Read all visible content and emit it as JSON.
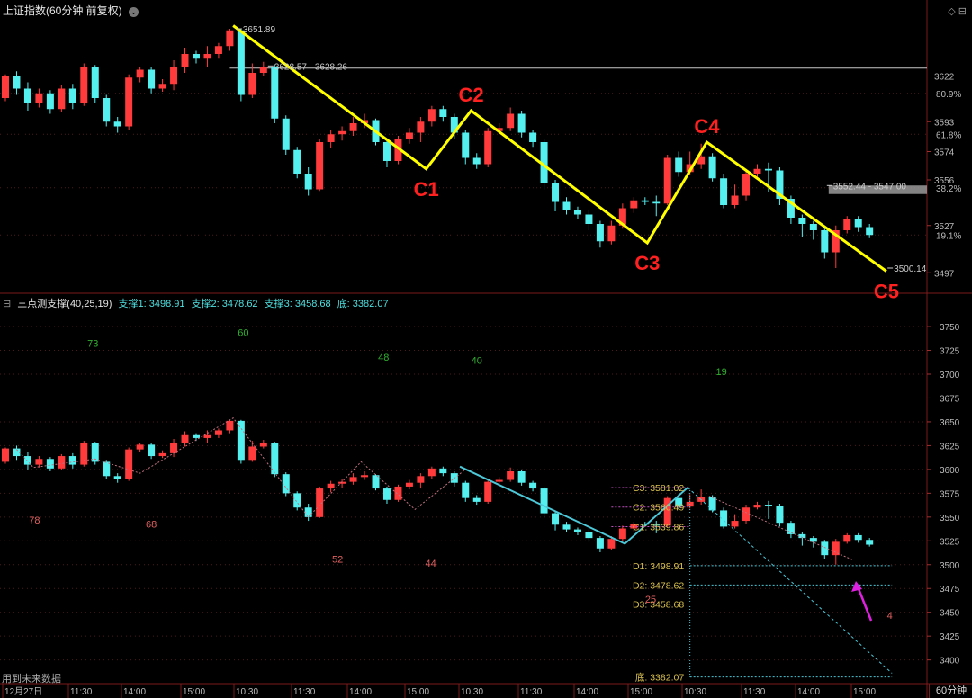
{
  "header": {
    "title": "上证指数(60分钟 前复权)",
    "controls": "◇ ⊟"
  },
  "indicator_header": {
    "name": "三点测支撑(40,25,19)",
    "s1": "支撑1: 3498.91",
    "s2": "支撑2: 3478.62",
    "s3": "支撑3: 3458.68",
    "bottom": "底: 3382.07"
  },
  "period_label": "60分钟",
  "footer_note": "用到未来数据",
  "colors": {
    "up": "#ff3b3b",
    "down": "#54f0f0",
    "zigzag": "#ffff00",
    "label": "#ff2020",
    "trend": "#4cc8d8",
    "dotted": "#d8c050",
    "arrow": "#e020e0",
    "grid": "#4a1a1a",
    "axis": "#7a1a1a"
  },
  "time_axis": [
    "12月27日",
    "11:30",
    "14:00",
    "15:00",
    "10:30",
    "11:30",
    "14:00",
    "15:00",
    "10:30",
    "11:30",
    "14:00",
    "15:00",
    "10:30",
    "11:30",
    "14:00",
    "15:00"
  ],
  "chart_data": [
    {
      "type": "candlestick",
      "title": "上证指数(60分钟 前复权)",
      "y_ticks": [
        3622,
        3593,
        3574,
        3556,
        3527,
        3497
      ],
      "pct_ticks": [
        {
          "label": "80.9%",
          "value": 3611
        },
        {
          "label": "61.8%",
          "value": 3585
        },
        {
          "label": "38.2%",
          "value": 3551
        },
        {
          "label": "19.1%",
          "value": 3521
        }
      ],
      "ylim": [
        3484,
        3660
      ],
      "candles": [
        [
          3608,
          3622,
          3623,
          3606
        ],
        [
          3622,
          3614,
          3625,
          3610
        ],
        [
          3614,
          3605,
          3618,
          3600
        ],
        [
          3605,
          3611,
          3614,
          3602
        ],
        [
          3611,
          3601,
          3613,
          3598
        ],
        [
          3601,
          3614,
          3616,
          3599
        ],
        [
          3614,
          3605,
          3617,
          3601
        ],
        [
          3605,
          3628,
          3630,
          3603
        ],
        [
          3628,
          3608,
          3629,
          3605
        ],
        [
          3608,
          3593,
          3610,
          3590
        ],
        [
          3593,
          3590,
          3596,
          3586
        ],
        [
          3590,
          3621,
          3623,
          3588
        ],
        [
          3621,
          3626,
          3628,
          3618
        ],
        [
          3626,
          3614,
          3628,
          3611
        ],
        [
          3614,
          3617,
          3620,
          3612
        ],
        [
          3617,
          3628,
          3632,
          3613
        ],
        [
          3628,
          3636,
          3640,
          3624
        ],
        [
          3636,
          3633,
          3638,
          3630
        ],
        [
          3633,
          3636,
          3641,
          3628
        ],
        [
          3636,
          3641,
          3643,
          3633
        ],
        [
          3641,
          3651,
          3652,
          3638
        ],
        [
          3651,
          3610,
          3652,
          3606
        ],
        [
          3610,
          3624,
          3630,
          3608
        ],
        [
          3624,
          3628,
          3631,
          3622
        ],
        [
          3628,
          3595,
          3629,
          3592
        ],
        [
          3595,
          3575,
          3597,
          3572
        ],
        [
          3575,
          3560,
          3577,
          3557
        ],
        [
          3560,
          3550,
          3564,
          3546
        ],
        [
          3550,
          3580,
          3582,
          3549
        ],
        [
          3580,
          3585,
          3588,
          3576
        ],
        [
          3585,
          3587,
          3590,
          3581
        ],
        [
          3587,
          3592,
          3596,
          3584
        ],
        [
          3592,
          3594,
          3598,
          3589
        ],
        [
          3594,
          3580,
          3595,
          3578
        ],
        [
          3580,
          3568,
          3582,
          3564
        ],
        [
          3568,
          3582,
          3584,
          3566
        ],
        [
          3582,
          3586,
          3589,
          3579
        ],
        [
          3586,
          3593,
          3596,
          3580
        ],
        [
          3593,
          3601,
          3603,
          3590
        ],
        [
          3601,
          3596,
          3603,
          3593
        ],
        [
          3596,
          3586,
          3598,
          3582
        ],
        [
          3586,
          3570,
          3588,
          3566
        ],
        [
          3570,
          3566,
          3573,
          3563
        ],
        [
          3566,
          3587,
          3589,
          3564
        ],
        [
          3587,
          3589,
          3592,
          3585
        ],
        [
          3589,
          3598,
          3602,
          3587
        ],
        [
          3598,
          3586,
          3600,
          3583
        ],
        [
          3586,
          3580,
          3588,
          3577
        ],
        [
          3580,
          3554,
          3582,
          3550
        ],
        [
          3554,
          3542,
          3556,
          3536
        ],
        [
          3542,
          3537,
          3545,
          3534
        ],
        [
          3537,
          3534,
          3539,
          3531
        ],
        [
          3534,
          3528,
          3537,
          3524
        ],
        [
          3528,
          3517,
          3530,
          3513
        ],
        [
          3517,
          3527,
          3530,
          3515
        ],
        [
          3527,
          3538,
          3541,
          3525
        ],
        [
          3538,
          3543,
          3545,
          3535
        ],
        [
          3543,
          3542,
          3545,
          3540
        ],
        [
          3542,
          3541,
          3546,
          3533
        ],
        [
          3541,
          3570,
          3572,
          3540
        ],
        [
          3570,
          3561,
          3574,
          3558
        ],
        [
          3561,
          3566,
          3574,
          3559
        ],
        [
          3566,
          3571,
          3579,
          3563
        ],
        [
          3571,
          3557,
          3573,
          3555
        ],
        [
          3557,
          3540,
          3560,
          3538
        ],
        [
          3540,
          3546,
          3553,
          3538
        ],
        [
          3546,
          3560,
          3563,
          3543
        ],
        [
          3560,
          3563,
          3566,
          3558
        ],
        [
          3563,
          3562,
          3567,
          3548
        ],
        [
          3562,
          3544,
          3564,
          3540
        ],
        [
          3544,
          3532,
          3546,
          3528
        ],
        [
          3532,
          3528,
          3534,
          3520
        ],
        [
          3528,
          3524,
          3530,
          3518
        ],
        [
          3524,
          3510,
          3526,
          3506
        ],
        [
          3510,
          3524,
          3527,
          3500
        ],
        [
          3524,
          3531,
          3533,
          3522
        ],
        [
          3531,
          3526,
          3533,
          3523
        ],
        [
          3526,
          3521,
          3528,
          3519
        ]
      ],
      "zigzag": [
        {
          "i": 20.3,
          "v": 3654
        },
        {
          "i": 37.5,
          "v": 3563
        },
        {
          "i": 41.5,
          "v": 3600
        },
        {
          "i": 57.2,
          "v": 3516
        },
        {
          "i": 62.5,
          "v": 3580
        },
        {
          "i": 78.5,
          "v": 3498
        }
      ],
      "zigzag_labels": [
        {
          "label": "C1",
          "i": 37.5,
          "v": 3563,
          "pos": "below"
        },
        {
          "label": "C2",
          "i": 41.5,
          "v": 3600,
          "pos": "above"
        },
        {
          "label": "C3",
          "i": 57.2,
          "v": 3516,
          "pos": "below"
        },
        {
          "label": "C4",
          "i": 62.5,
          "v": 3580,
          "pos": "above"
        },
        {
          "label": "C5",
          "i": 78.5,
          "v": 3498,
          "pos": "below"
        }
      ],
      "annotations": [
        {
          "text": "3651.89",
          "i": 20.6,
          "v": 3652
        },
        {
          "text": "3628.57 - 3628.26",
          "i": 23.4,
          "v": 3628.4
        },
        {
          "text": "3552.44 - 3547.00",
          "i": 73.2,
          "v": 3552.4
        },
        {
          "text": "3500.14",
          "i": 78.6,
          "v": 3500
        }
      ],
      "hline": {
        "v": 3627
      },
      "gap_box": {
        "from_i": 73.2,
        "to": 3547,
        "top": 3552.44
      }
    },
    {
      "type": "candlestick",
      "title": "三点测支撑(40,25,19)",
      "y_ticks": [
        3750,
        3725,
        3700,
        3675,
        3650,
        3625,
        3600,
        3575,
        3550,
        3525,
        3500,
        3475,
        3450,
        3425,
        3400
      ],
      "ylim": [
        3377,
        3768
      ],
      "support_levels": [
        {
          "label": "C3: 3581.02",
          "value": 3581.02
        },
        {
          "label": "C2: 3560.49",
          "value": 3560.49
        },
        {
          "label": "C1: 3539.86",
          "value": 3539.86
        },
        {
          "label": "D1: 3498.91",
          "value": 3498.91
        },
        {
          "label": "D2: 3478.62",
          "value": 3478.62
        },
        {
          "label": "D3: 3458.68",
          "value": 3458.68
        },
        {
          "label": "底: 3382.07",
          "value": 3382.07
        }
      ],
      "numbers": [
        {
          "text": "73",
          "i": 7.8,
          "v": 3729,
          "color": "#30b030"
        },
        {
          "text": "60",
          "i": 21.2,
          "v": 3740,
          "color": "#30b030"
        },
        {
          "text": "48",
          "i": 33.7,
          "v": 3714,
          "color": "#30b030"
        },
        {
          "text": "40",
          "i": 42.0,
          "v": 3711,
          "color": "#30b030"
        },
        {
          "text": "19",
          "i": 63.8,
          "v": 3699,
          "color": "#30b030"
        },
        {
          "text": "78",
          "i": 2.6,
          "v": 3543,
          "color": "#e06060"
        },
        {
          "text": "68",
          "i": 13.0,
          "v": 3539,
          "color": "#e06060"
        },
        {
          "text": "52",
          "i": 29.6,
          "v": 3502,
          "color": "#e06060"
        },
        {
          "text": "44",
          "i": 37.9,
          "v": 3498,
          "color": "#e06060"
        },
        {
          "text": "25",
          "i": 57.5,
          "v": 3460,
          "color": "#e06060"
        },
        {
          "text": "4",
          "i": 78.8,
          "v": 3443,
          "color": "#e06060"
        }
      ]
    }
  ]
}
